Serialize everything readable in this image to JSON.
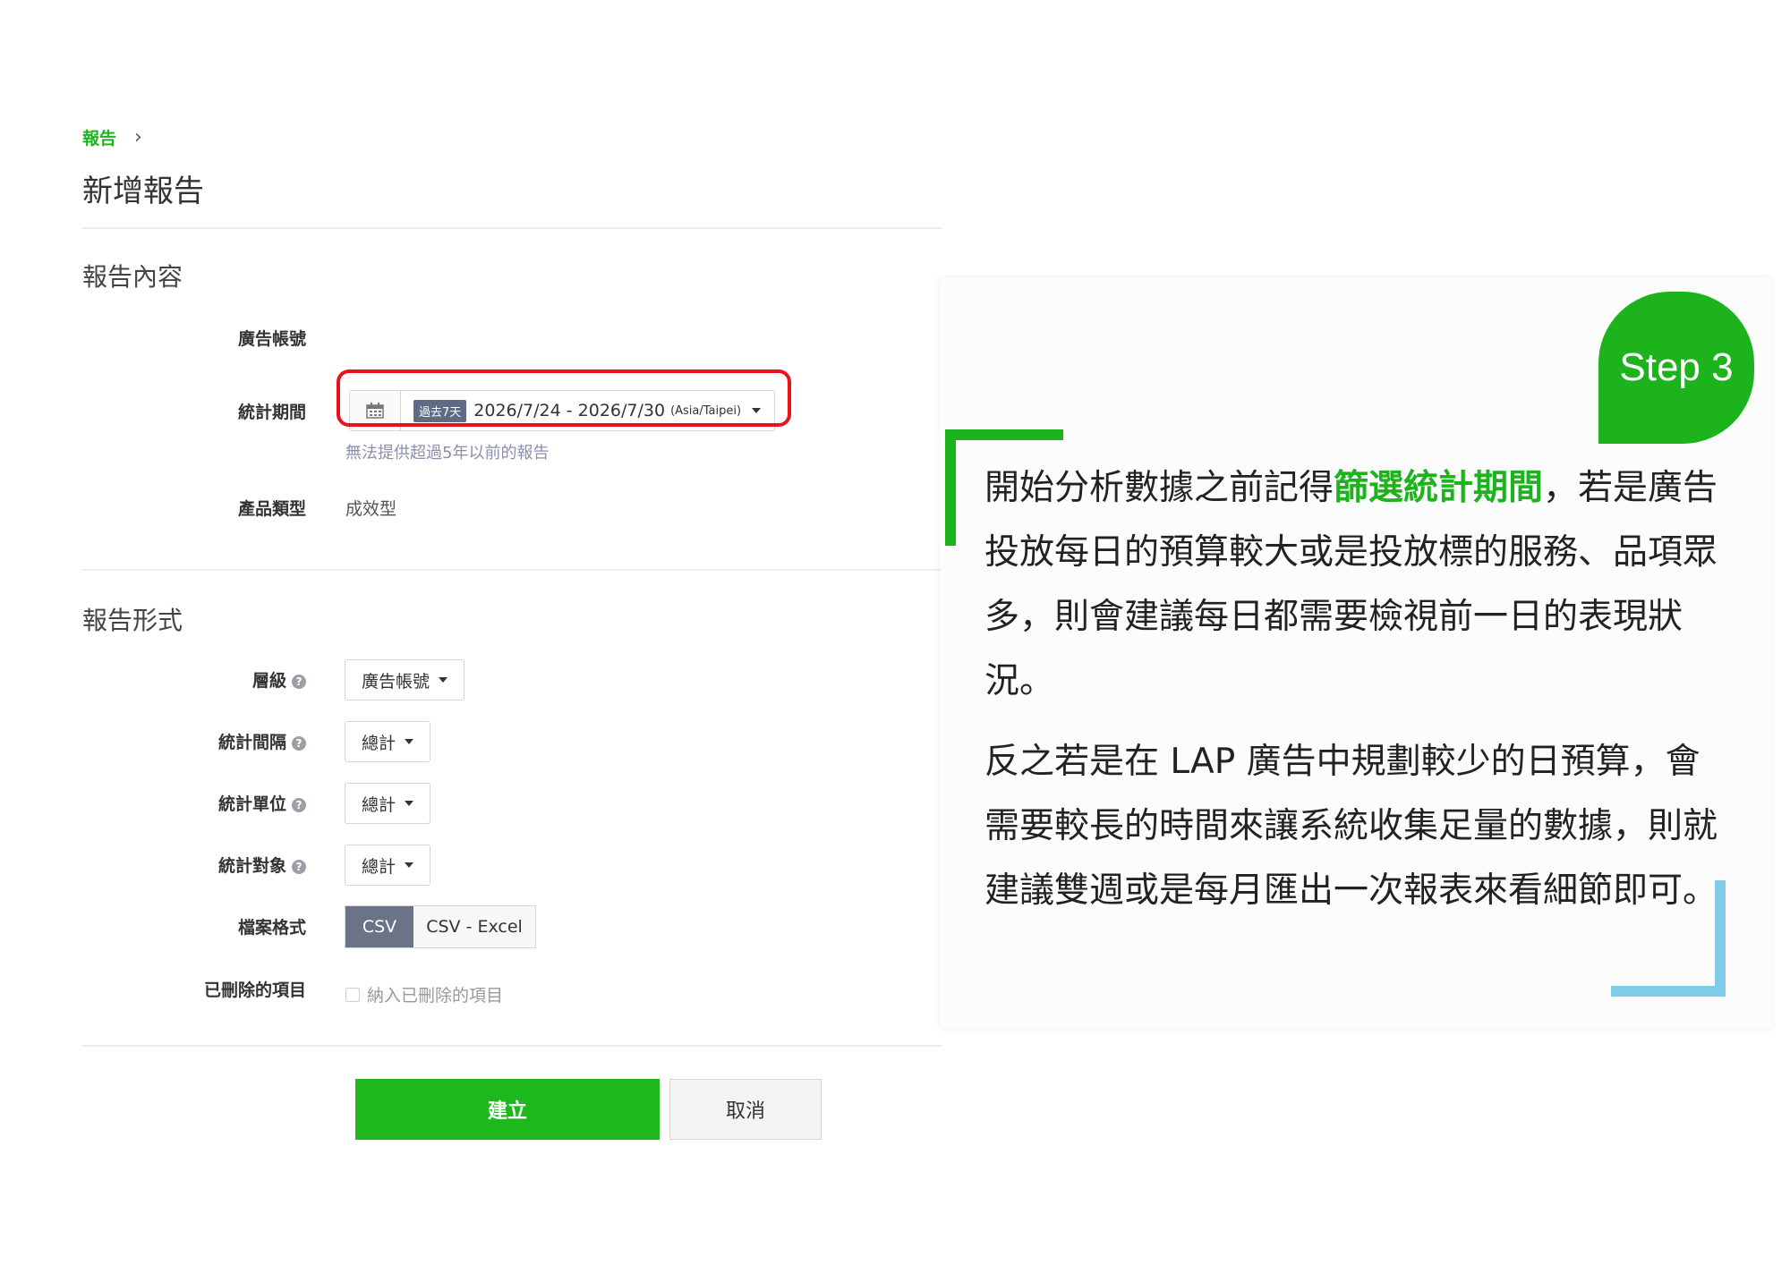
{
  "breadcrumb": {
    "parent": "報告",
    "separator": "›"
  },
  "page_title": "新增報告",
  "section_content": {
    "title": "報告內容",
    "ad_account_label": "廣告帳號",
    "period_label": "統計期間",
    "period_badge": "過去7天",
    "period_range": "2026/7/24 - 2026/7/30",
    "period_tz": "(Asia/Taipei)",
    "period_hint": "無法提供超過5年以前的報告",
    "product_type_label": "產品類型",
    "product_type_value": "成效型"
  },
  "section_format": {
    "title": "報告形式",
    "level_label": "層級",
    "level_value": "廣告帳號",
    "interval_label": "統計間隔",
    "interval_value": "總計",
    "unit_label": "統計單位",
    "unit_value": "總計",
    "target_label": "統計對象",
    "target_value": "總計",
    "file_format_label": "檔案格式",
    "file_formats": [
      "CSV",
      "CSV - Excel"
    ],
    "deleted_label": "已刪除的項目",
    "deleted_checkbox": "納入已刪除的項目"
  },
  "actions": {
    "create": "建立",
    "cancel": "取消"
  },
  "help_glyph": "?",
  "panel": {
    "step": "Step 3",
    "p1_before": "開始分析數據之前記得",
    "p1_highlight": "篩選統計期間",
    "p1_after": "，若是廣告投放每日的預算較大或是投放標的服務、品項眾多，則會建議每日都需要檢視前一日的表現狀況。",
    "p2": "反之若是在 LAP 廣告中規劃較少的日預算，會需要較長的時間來讓系統收集足量的數據，則就建議雙週或是每月匯出一次報表來看細節即可。"
  },
  "colors": {
    "brand_green": "#1db31d",
    "highlight_red": "#e8141a",
    "accent_blue": "#7fcbe8"
  }
}
